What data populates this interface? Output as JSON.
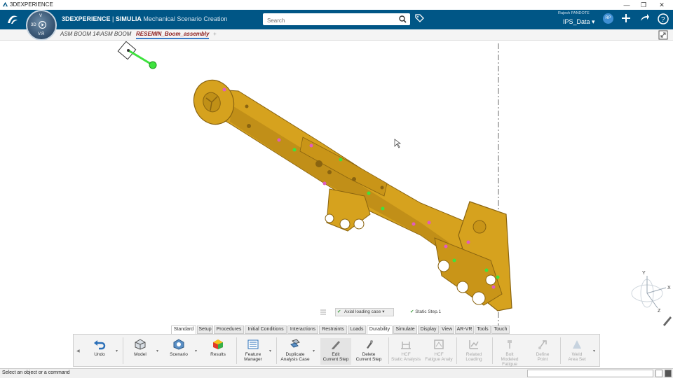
{
  "window": {
    "title": "3DEXPERIENCE",
    "minimize": "—",
    "restore": "❐",
    "close": "✕"
  },
  "compass": {
    "top_label": "V",
    "left_label": "3D",
    "bottom_label": "V.R"
  },
  "brand": {
    "product": "3DEXPERIENCE",
    "separator": " | ",
    "company": "SIMULIA",
    "app": "Mechanical Scenario Creation"
  },
  "search": {
    "placeholder": "Search"
  },
  "user": {
    "name": "Rajesh PANDOTE",
    "tenant": "IPS_Data",
    "initials": "RP"
  },
  "tabs": [
    {
      "label": "ASM BOOM 14\\ASM BOOM"
    },
    {
      "label": "RESEMIN_Boom_assembly"
    },
    {
      "label": "+"
    }
  ],
  "case_bar": {
    "case": "Axial loading case",
    "step": "Static Step.1"
  },
  "compass_axes": {
    "y": "Y",
    "x": "X",
    "z": "Z"
  },
  "ribbon_tabs": [
    "Standard",
    "Setup",
    "Procedures",
    "Initial Conditions",
    "Interactions",
    "Restraints",
    "Loads",
    "Durability",
    "Simulate",
    "Display",
    "View",
    "AR-VR",
    "Tools",
    "Touch"
  ],
  "ribbon_buttons": {
    "undo": "Undo",
    "model": "Model",
    "scenario": "Scenario",
    "results": "Results",
    "feature_manager": [
      "Feature",
      "Manager"
    ],
    "duplicate_case": [
      "Duplicate",
      "Analysis Case"
    ],
    "edit_step": [
      "Edit",
      "Current Step"
    ],
    "delete_step": [
      "Delete",
      "Current Step"
    ],
    "hcf": [
      "HCF",
      "Static Analysis"
    ],
    "hcf_fatigue": [
      "HCF",
      "Fatigue Analy"
    ],
    "related_loading": [
      "Related",
      "Loading"
    ],
    "bolt": [
      "Bolt",
      "Modeled Fatigue"
    ],
    "spot": [
      "Define",
      "Point"
    ],
    "weld": [
      "Weld",
      "Area Set"
    ]
  },
  "status": {
    "message": "Select an object or a command"
  },
  "colors": {
    "topbar": "#005686",
    "part": "#d6a21e",
    "part_dark": "#8a6410",
    "accent_green": "#3ee23e",
    "accent_pink": "#e05cc0"
  }
}
